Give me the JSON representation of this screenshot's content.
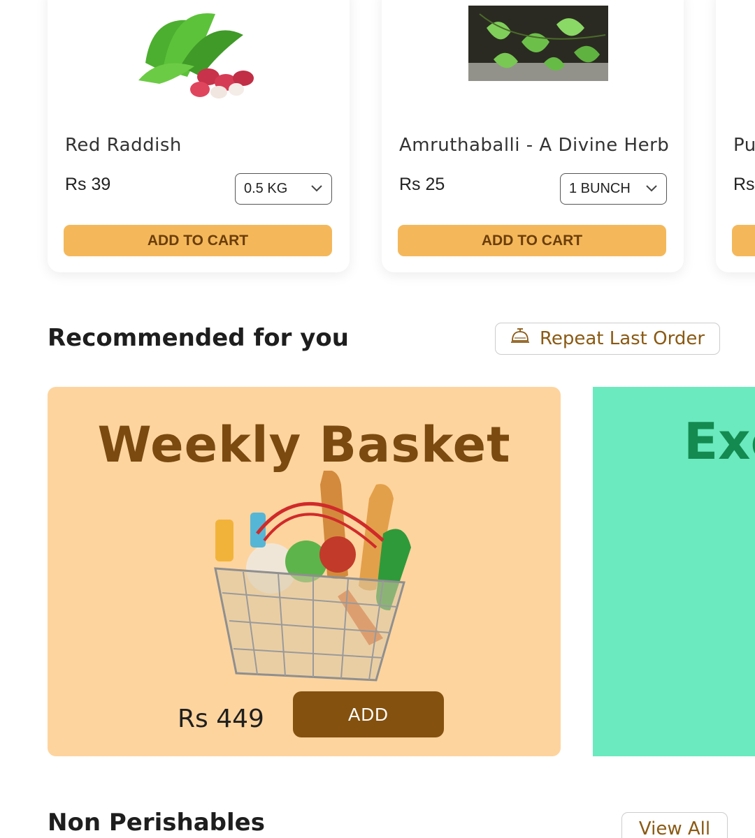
{
  "products": [
    {
      "name": "Red Raddish",
      "price": "Rs 39",
      "quantity": "0.5 KG",
      "button": "ADD TO CART",
      "image": "red-radish-image"
    },
    {
      "name": "Amruthaballi - A Divine Herb",
      "price": "Rs 25",
      "quantity": "1 BUNCH",
      "button": "ADD TO CART",
      "image": "amruthaballi-leaves-image"
    },
    {
      "name": "Pu",
      "price": "Rs",
      "button": ""
    }
  ],
  "recommended": {
    "title": "Recommended for you",
    "repeat_button": "Repeat Last Order",
    "repeat_icon": "service-bell-icon"
  },
  "promo": {
    "title": "Weekly Basket",
    "price": "Rs 449",
    "add_label": "ADD",
    "image": "grocery-basket-image"
  },
  "promo2": {
    "title": "Exc"
  },
  "non_perishables": {
    "title": "Non Perishables",
    "view_all": "View All"
  },
  "colors": {
    "accent_button": "#f4b85b",
    "brown": "#84510f",
    "promo_bg": "#fed49e",
    "promo2_bg": "#6aeabe"
  }
}
